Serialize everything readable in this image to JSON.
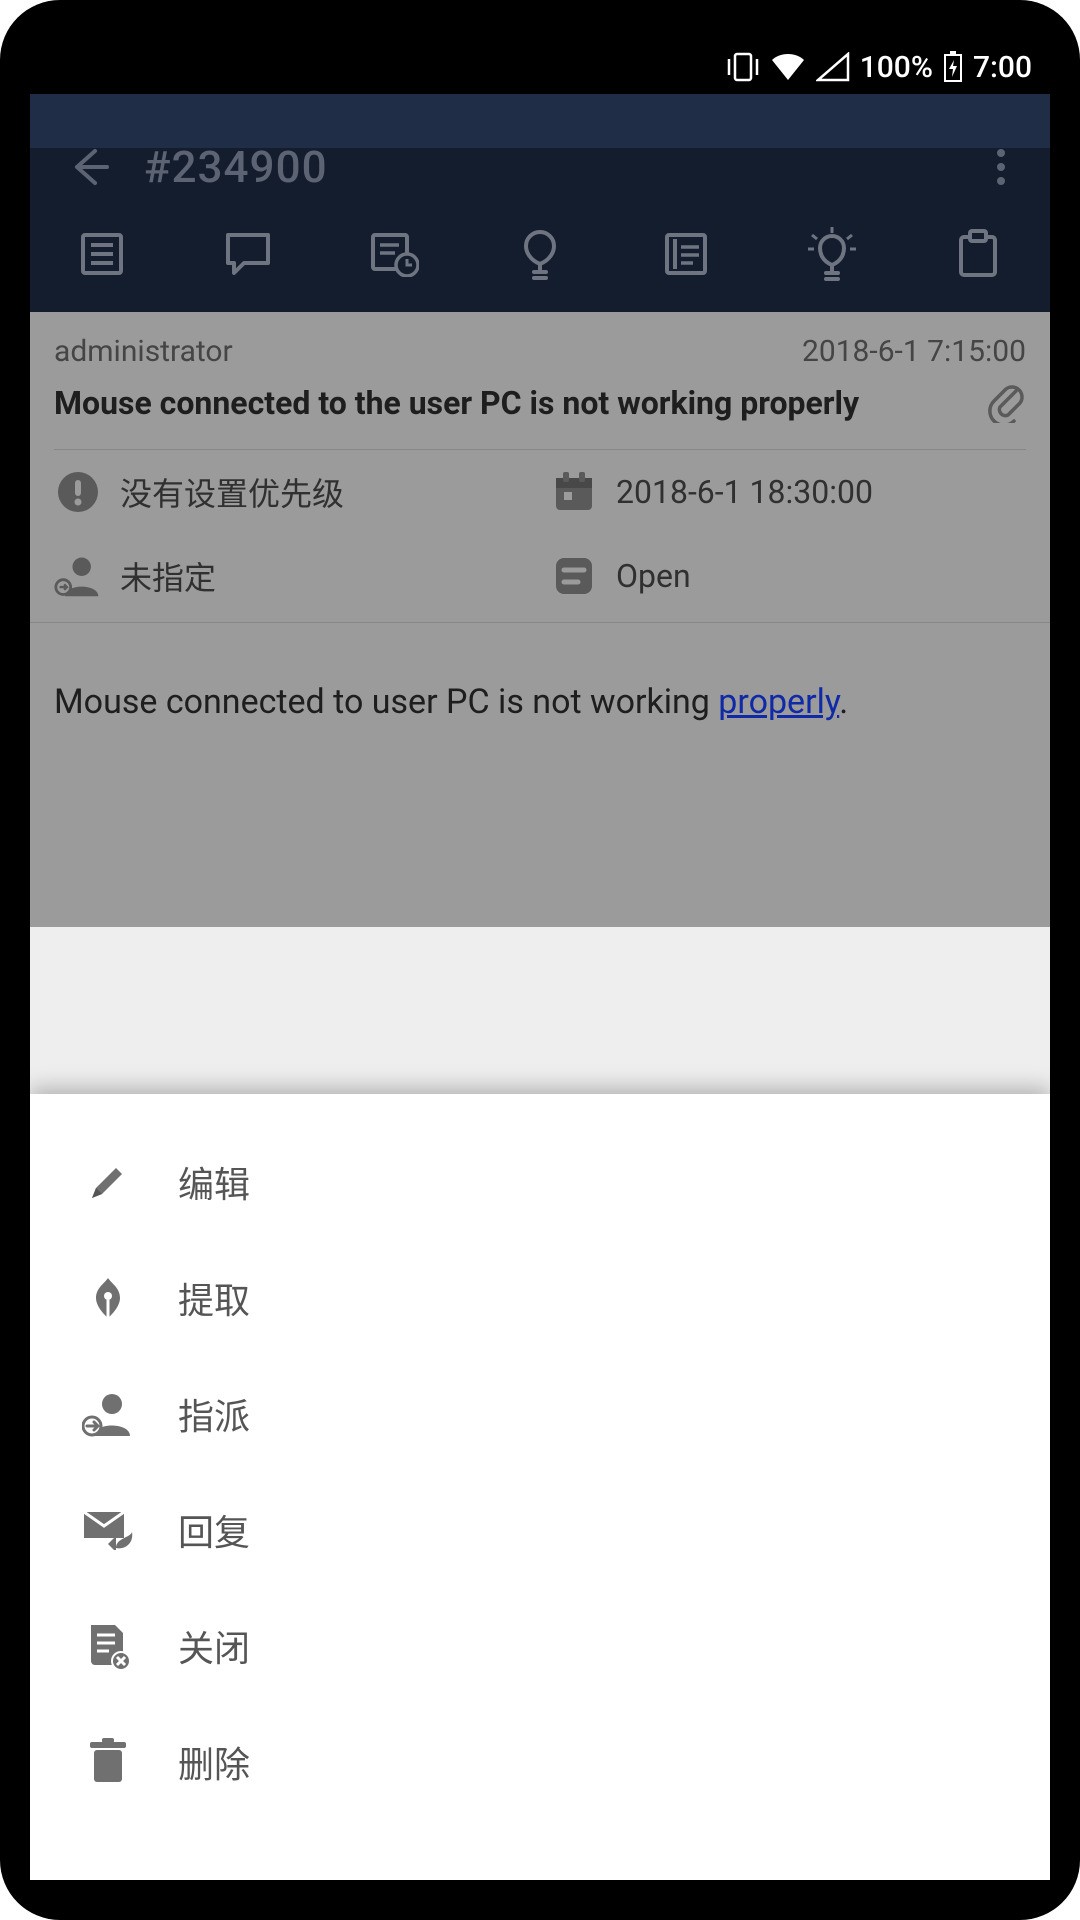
{
  "status": {
    "battery": "100%",
    "time": "7:00"
  },
  "header": {
    "title": "#234900"
  },
  "ticket": {
    "reporter": "administrator",
    "created": "2018-6-1 7:15:00",
    "subject": "Mouse connected to the user PC is not working properly",
    "priority_text": "没有设置优先级",
    "due_date": "2018-6-1 18:30:00",
    "assignee": "未指定",
    "status": "Open",
    "body_prefix": "Mouse connected to user PC is not working ",
    "body_link": "properly",
    "body_suffix": "."
  },
  "sheet": {
    "items": [
      {
        "label": "编辑"
      },
      {
        "label": "提取"
      },
      {
        "label": "指派"
      },
      {
        "label": "回复"
      },
      {
        "label": "关闭"
      },
      {
        "label": "删除"
      }
    ]
  }
}
